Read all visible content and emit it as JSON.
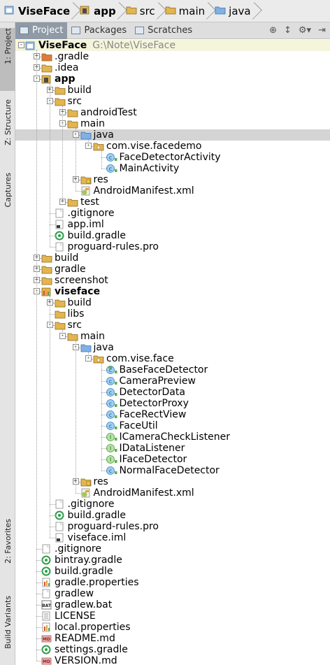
{
  "breadcrumb": [
    {
      "label": "ViseFace",
      "icon": "project-module-icon",
      "bold": true
    },
    {
      "label": "app",
      "icon": "android-module-icon",
      "bold": true
    },
    {
      "label": "src",
      "icon": "folder-icon",
      "bold": false
    },
    {
      "label": "main",
      "icon": "folder-icon",
      "bold": false
    },
    {
      "label": "java",
      "icon": "source-folder-icon",
      "bold": false
    }
  ],
  "left_strip": {
    "project_tab": "1: Project",
    "structure_tab": "Z: Structure",
    "captures_tab": "Captures",
    "favorites_tab": "2: Favorites",
    "build_variants_tab": "Build Variants"
  },
  "toolbar": {
    "tabs": [
      {
        "label": "Project"
      },
      {
        "label": "Packages"
      },
      {
        "label": "Scratches"
      }
    ],
    "right_icons": [
      "locate-icon",
      "collapse-all-icon",
      "settings-gear-icon",
      "hide-icon"
    ]
  },
  "tree": [
    {
      "depth": 0,
      "expand": "-",
      "icon": "project-module",
      "label": "ViseFace",
      "path": "G:\\Note\\ViseFace",
      "bold": true
    },
    {
      "depth": 1,
      "expand": "+",
      "icon": "folder-orange",
      "label": ".gradle"
    },
    {
      "depth": 1,
      "expand": "+",
      "icon": "folder",
      "label": ".idea"
    },
    {
      "depth": 1,
      "expand": "-",
      "icon": "android-module",
      "label": "app",
      "bold": true
    },
    {
      "depth": 2,
      "expand": "+",
      "icon": "folder",
      "label": "build"
    },
    {
      "depth": 2,
      "expand": "-",
      "icon": "folder",
      "label": "src"
    },
    {
      "depth": 3,
      "expand": "+",
      "icon": "folder",
      "label": "androidTest"
    },
    {
      "depth": 3,
      "expand": "-",
      "icon": "folder",
      "label": "main"
    },
    {
      "depth": 4,
      "expand": "-",
      "icon": "folder-source",
      "label": "java",
      "selected": true
    },
    {
      "depth": 5,
      "expand": "-",
      "icon": "package",
      "label": "com.vise.facedemo"
    },
    {
      "depth": 6,
      "expand": "",
      "icon": "class",
      "label": "FaceDetectorActivity"
    },
    {
      "depth": 6,
      "expand": "",
      "icon": "class",
      "label": "MainActivity"
    },
    {
      "depth": 4,
      "expand": "+",
      "icon": "folder-res",
      "label": "res"
    },
    {
      "depth": 4,
      "expand": "",
      "icon": "manifest",
      "label": "AndroidManifest.xml"
    },
    {
      "depth": 3,
      "expand": "+",
      "icon": "folder",
      "label": "test"
    },
    {
      "depth": 2,
      "expand": "",
      "icon": "file",
      "label": ".gitignore"
    },
    {
      "depth": 2,
      "expand": "",
      "icon": "iml",
      "label": "app.iml"
    },
    {
      "depth": 2,
      "expand": "",
      "icon": "gradle",
      "label": "build.gradle"
    },
    {
      "depth": 2,
      "expand": "",
      "icon": "file",
      "label": "proguard-rules.pro"
    },
    {
      "depth": 1,
      "expand": "+",
      "icon": "folder",
      "label": "build"
    },
    {
      "depth": 1,
      "expand": "+",
      "icon": "folder",
      "label": "gradle"
    },
    {
      "depth": 1,
      "expand": "+",
      "icon": "folder",
      "label": "screenshot"
    },
    {
      "depth": 1,
      "expand": "-",
      "icon": "library-module",
      "label": "viseface",
      "bold": true
    },
    {
      "depth": 2,
      "expand": "+",
      "icon": "folder",
      "label": "build"
    },
    {
      "depth": 2,
      "expand": "",
      "icon": "folder",
      "label": "libs"
    },
    {
      "depth": 2,
      "expand": "-",
      "icon": "folder",
      "label": "src"
    },
    {
      "depth": 3,
      "expand": "-",
      "icon": "folder",
      "label": "main"
    },
    {
      "depth": 4,
      "expand": "-",
      "icon": "folder-source",
      "label": "java"
    },
    {
      "depth": 5,
      "expand": "-",
      "icon": "package",
      "label": "com.vise.face"
    },
    {
      "depth": 6,
      "expand": "",
      "icon": "class-abstract",
      "label": "BaseFaceDetector"
    },
    {
      "depth": 6,
      "expand": "",
      "icon": "class",
      "label": "CameraPreview"
    },
    {
      "depth": 6,
      "expand": "",
      "icon": "class",
      "label": "DetectorData"
    },
    {
      "depth": 6,
      "expand": "",
      "icon": "class",
      "label": "DetectorProxy"
    },
    {
      "depth": 6,
      "expand": "",
      "icon": "class",
      "label": "FaceRectView"
    },
    {
      "depth": 6,
      "expand": "",
      "icon": "class",
      "label": "FaceUtil"
    },
    {
      "depth": 6,
      "expand": "",
      "icon": "interface",
      "label": "ICameraCheckListener"
    },
    {
      "depth": 6,
      "expand": "",
      "icon": "interface",
      "label": "IDataListener"
    },
    {
      "depth": 6,
      "expand": "",
      "icon": "interface",
      "label": "IFaceDetector"
    },
    {
      "depth": 6,
      "expand": "",
      "icon": "class",
      "label": "NormalFaceDetector"
    },
    {
      "depth": 4,
      "expand": "+",
      "icon": "folder-res",
      "label": "res"
    },
    {
      "depth": 4,
      "expand": "",
      "icon": "manifest",
      "label": "AndroidManifest.xml"
    },
    {
      "depth": 2,
      "expand": "",
      "icon": "file",
      "label": ".gitignore"
    },
    {
      "depth": 2,
      "expand": "",
      "icon": "gradle",
      "label": "build.gradle"
    },
    {
      "depth": 2,
      "expand": "",
      "icon": "file",
      "label": "proguard-rules.pro"
    },
    {
      "depth": 2,
      "expand": "",
      "icon": "iml",
      "label": "viseface.iml"
    },
    {
      "depth": 1,
      "expand": "",
      "icon": "file",
      "label": ".gitignore"
    },
    {
      "depth": 1,
      "expand": "",
      "icon": "gradle",
      "label": "bintray.gradle"
    },
    {
      "depth": 1,
      "expand": "",
      "icon": "gradle",
      "label": "build.gradle"
    },
    {
      "depth": 1,
      "expand": "",
      "icon": "properties",
      "label": "gradle.properties"
    },
    {
      "depth": 1,
      "expand": "",
      "icon": "file",
      "label": "gradlew"
    },
    {
      "depth": 1,
      "expand": "",
      "icon": "bat",
      "label": "gradlew.bat"
    },
    {
      "depth": 1,
      "expand": "",
      "icon": "text",
      "label": "LICENSE"
    },
    {
      "depth": 1,
      "expand": "",
      "icon": "properties",
      "label": "local.properties"
    },
    {
      "depth": 1,
      "expand": "",
      "icon": "markdown",
      "label": "README.md"
    },
    {
      "depth": 1,
      "expand": "",
      "icon": "gradle",
      "label": "settings.gradle"
    },
    {
      "depth": 1,
      "expand": "",
      "icon": "markdown",
      "label": "VERSION.md"
    }
  ],
  "icon_names": {
    "project-module": "project-module-icon",
    "android-module": "android-module-icon",
    "library-module": "library-module-icon",
    "folder": "folder-icon",
    "folder-orange": "excluded-folder-icon",
    "folder-source": "source-folder-icon",
    "folder-res": "resources-folder-icon",
    "package": "package-icon",
    "class": "class-icon",
    "class-abstract": "abstract-class-icon",
    "interface": "interface-icon",
    "manifest": "android-manifest-icon",
    "file": "file-icon",
    "iml": "module-file-icon",
    "gradle": "gradle-file-icon",
    "properties": "properties-file-icon",
    "bat": "bat-file-icon",
    "text": "text-file-icon",
    "markdown": "markdown-file-icon"
  },
  "colors": {
    "selected_row": "#d4d4d4",
    "folder": "#d9a93f",
    "source_folder": "#6a9bd8",
    "class_icon": "#5aa2e0",
    "interface_icon": "#6cc06a",
    "gradle": "#2e9e4a"
  }
}
